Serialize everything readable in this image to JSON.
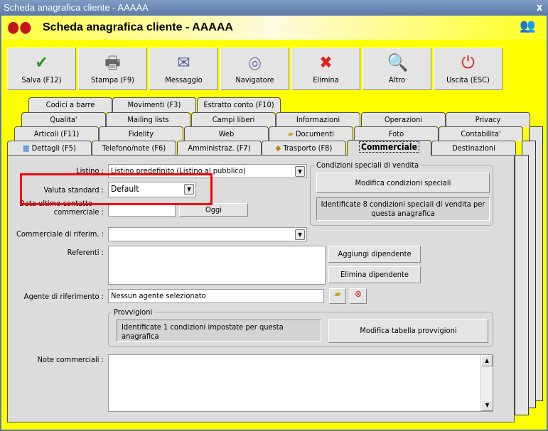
{
  "window": {
    "title": "Scheda anagrafica cliente - AAAAA",
    "close": "x"
  },
  "header": {
    "title": "Scheda anagrafica cliente - AAAAA"
  },
  "toolbar": [
    {
      "label": "Salva (F12)",
      "icon": "check-icon",
      "glyph": "✔",
      "color": "#2a9a2a"
    },
    {
      "label": "Stampa (F9)",
      "icon": "printer-icon",
      "glyph": "🖶",
      "color": "#666666"
    },
    {
      "label": "Messaggio",
      "icon": "envelope-pen-icon",
      "glyph": "✉",
      "color": "#5560a8"
    },
    {
      "label": "Navigatore",
      "icon": "compass-icon",
      "glyph": "◎",
      "color": "#7070b0"
    },
    {
      "label": "Elimina",
      "icon": "delete-x-icon",
      "glyph": "✖",
      "color": "#e02020"
    },
    {
      "label": "Altro",
      "icon": "magnifier-book-icon",
      "glyph": "🔍",
      "color": "#2050b0"
    },
    {
      "label": "Uscita (ESC)",
      "icon": "power-icon",
      "glyph": "⏻",
      "color": "#d03020"
    }
  ],
  "tabs": {
    "row1": [
      "Codici a barre",
      "Movimenti (F3)",
      "Estratto conto (F10)"
    ],
    "row2": [
      "Qualita'",
      "Mailing lists",
      "Campi liberi",
      "Informazioni",
      "Operazioni",
      "Privacy"
    ],
    "row3": [
      "Articoli (F11)",
      "Fidelity",
      "Web",
      "Documenti",
      "Foto",
      "Contabilita'"
    ],
    "row4": [
      "Dettagli (F5)",
      "Telefono/note (F6)",
      "Amministraz. (F7)",
      "Trasporto (F8)",
      "Commerciale",
      "Destinazioni"
    ]
  },
  "form": {
    "listino_label": "Listino :",
    "listino_value": "Listino predefinito (Listino al pubblico)",
    "valuta_label": "Valuta standard :",
    "valuta_value": "Default",
    "data_label_1": "Data ultimo contatto",
    "data_label_2": "commerciale :",
    "data_value": "",
    "oggi": "Oggi",
    "commerciale_label": "Commerciale di riferim. :",
    "commerciale_value": "",
    "referenti_label": "Referenti :",
    "aggiungi": "Aggiungi dipendente",
    "elimina_dip": "Elimina dipendente",
    "agente_label": "Agente di riferimento :",
    "agente_value": "Nessun agente selezionato",
    "cond_title": "Condizioni speciali di vendita",
    "cond_button": "Modifica condizioni speciali",
    "cond_info": "Identificate 8 condizioni speciali di vendita per questa anagrafica",
    "provv_title": "Provvigioni",
    "provv_info": "Identificate 1 condizioni impostate per questa anagrafica",
    "provv_button": "Modifica tabella provvigioni",
    "note_label": "Note commerciali :",
    "note_value": ""
  }
}
